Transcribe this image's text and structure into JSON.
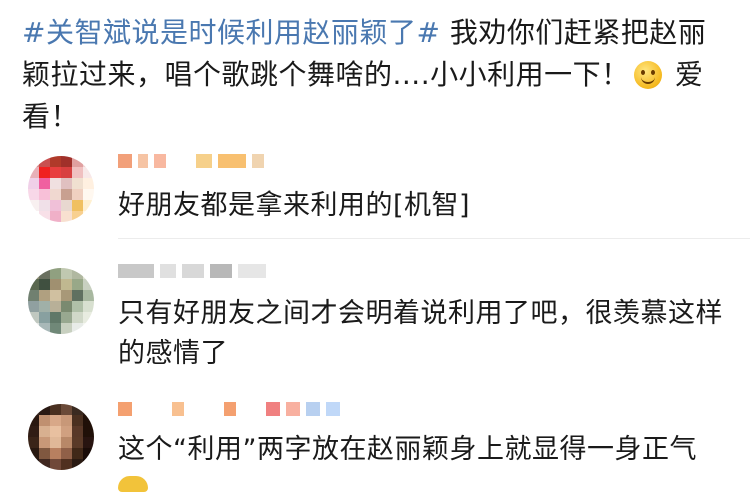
{
  "post": {
    "hashtag": "#关智斌说是时候利用赵丽颖了#",
    "text_before_emoji": " 我劝你们赶紧把赵丽颖拉过来，唱个歌跳个舞啥的....小小利用一下！",
    "text_after_emoji": " 爱看！",
    "emoji_icon": "smiley-face-icon"
  },
  "comments": [
    {
      "text": "好朋友都是拿来利用的[机智]"
    },
    {
      "text": "只有好朋友之间才会明着说利用了吧，很羡慕这样的感情了"
    },
    {
      "text": "这个“利用”两字放在赵丽颖身上就显得一身正气"
    }
  ],
  "colors": {
    "hashtag": "#4a78b0",
    "text": "#1a1a1a",
    "divider": "#ececec"
  }
}
